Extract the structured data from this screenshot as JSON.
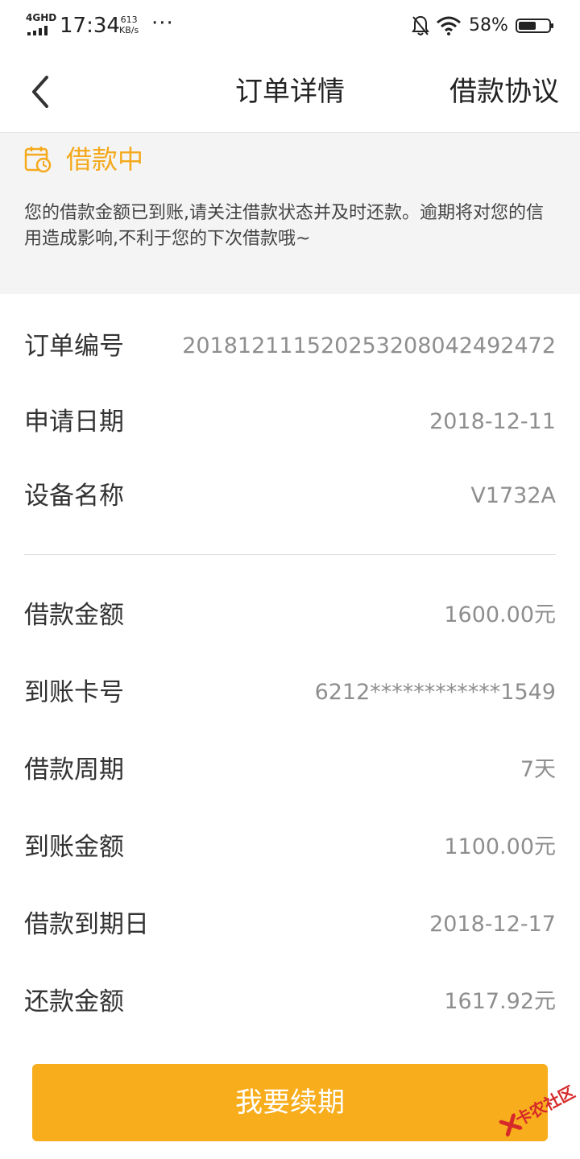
{
  "status_bar": {
    "network": "4GHD",
    "time": "17:34",
    "speed_value": "613",
    "speed_unit": "KB/s",
    "more": "···",
    "battery_percent": "58%",
    "battery_level": 0.58
  },
  "nav": {
    "title": "订单详情",
    "right_action": "借款协议"
  },
  "banner": {
    "status": "借款中",
    "notice": "您的借款金额已到账,请关注借款状态并及时还款。逾期将对您的信用造成影响,不利于您的下次借款哦~"
  },
  "rows": [
    {
      "label": "订单编号",
      "value": "20181211152025320804249 2472"
    },
    {
      "label": "申请日期",
      "value": "2018-12-11"
    },
    {
      "label": "设备名称",
      "value": "V1732A"
    },
    {
      "label": "借款金额",
      "value": "1600.00元"
    },
    {
      "label": "到账卡号",
      "value": "6212************1549"
    },
    {
      "label": "借款周期",
      "value": "7天"
    },
    {
      "label": "到账金额",
      "value": "1100.00元"
    },
    {
      "label": "借款到期日",
      "value": "2018-12-17"
    },
    {
      "label": "还款金额",
      "value": "1617.92元"
    }
  ],
  "button": {
    "label": "我要续期"
  },
  "watermark": {
    "text": "卡农社区"
  },
  "colors": {
    "accent": "#f8ad1d",
    "status_text": "#f5a91c",
    "banner_bg": "#f4f4f4",
    "watermark": "#d62a2a"
  }
}
